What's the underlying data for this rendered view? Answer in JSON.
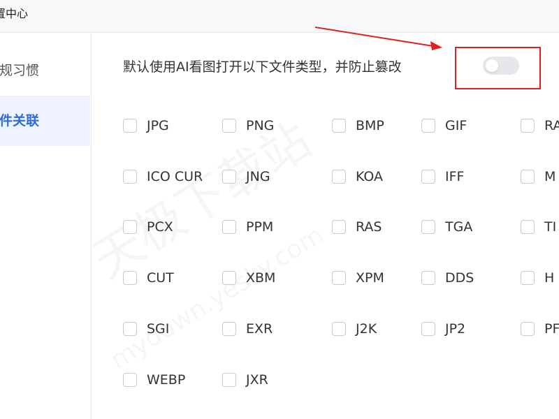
{
  "window": {
    "title": "置中心"
  },
  "sidebar": {
    "items": [
      {
        "label": "常规习惯",
        "active": false
      },
      {
        "label": "文件关联",
        "active": true
      }
    ]
  },
  "main": {
    "header": "默认使用AI看图打开以下文件类型，并防止篡改",
    "toggle": {
      "on": false
    }
  },
  "file_types": [
    [
      "JPG",
      "PNG",
      "BMP",
      "GIF",
      "RA"
    ],
    [
      "ICO CUR",
      "JNG",
      "KOA",
      "IFF",
      "M"
    ],
    [
      "PCX",
      "PPM",
      "RAS",
      "TGA",
      "TI"
    ],
    [
      "CUT",
      "XBM",
      "XPM",
      "DDS",
      "H"
    ],
    [
      "SGI",
      "EXR",
      "J2K",
      "JP2",
      "PF"
    ],
    [
      "WEBP",
      "JXR"
    ]
  ],
  "watermark": {
    "line1": "天极下载站",
    "line2": "mydown.yesky.com"
  },
  "colors": {
    "accent": "#2f6bd8",
    "annotation": "#e02020",
    "toggle_off": "#e5e7eb"
  }
}
